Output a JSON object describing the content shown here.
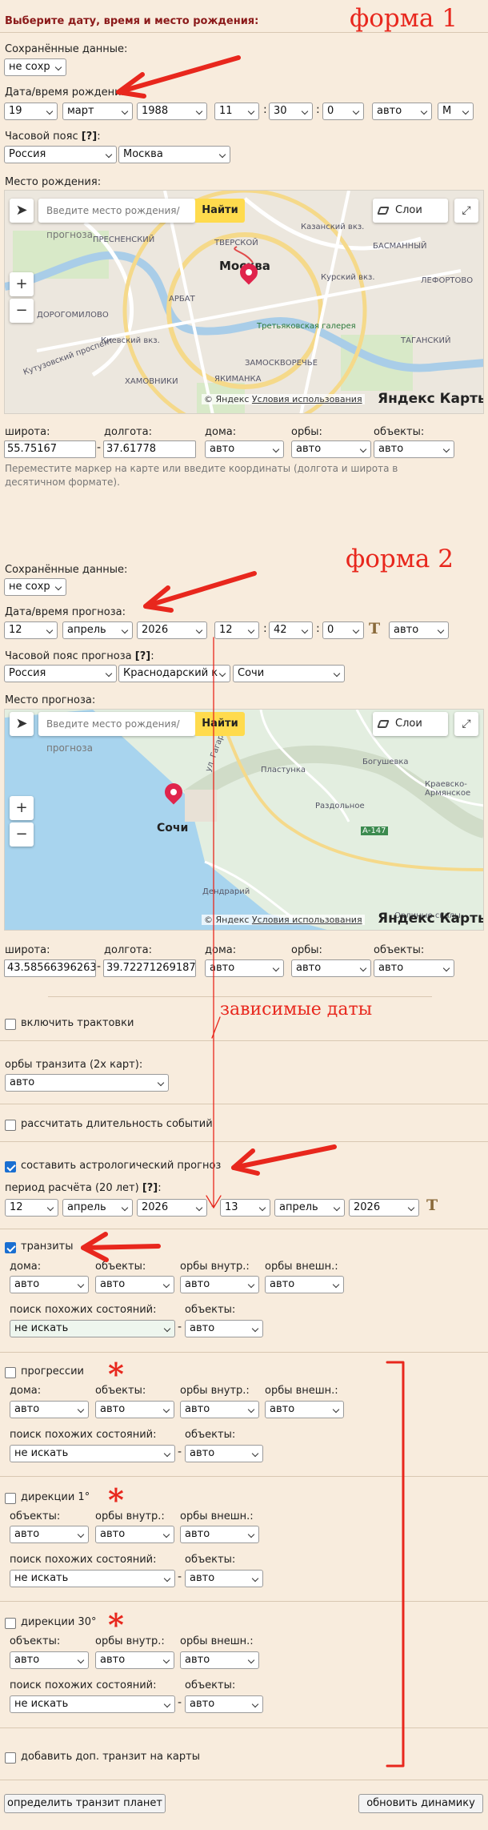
{
  "form1": {
    "title": "Выберите дату, время и место рождения:",
    "annotation": "форма 1",
    "saved_label": "Сохранённые данные:",
    "saved_value": "не сохр",
    "datetime_label": "Дата/время рождения:",
    "day": "19",
    "month": "март",
    "year": "1988",
    "hour": "11",
    "minute": "30",
    "second": "0",
    "mode": "авто",
    "last": "М",
    "tz_label": "Часовой пояс",
    "tz_help": "[?]",
    "tz_colon": ":",
    "tz_country": "Россия",
    "tz_city": "Москва",
    "place_label": "Место рождения:",
    "map": {
      "search_placeholder": "Введите место рождения/прогноза",
      "find": "Найти",
      "layers": "Слои",
      "copyright": "© Яндекс",
      "terms": "Условия использования",
      "logo": "Яндекс Карты",
      "labels": [
        "Москва",
        "ПРЕСНЕНСКИЙ",
        "ТВЕРСКОЙ",
        "Казанский вкз.",
        "БАСМАННЫЙ",
        "Курский вкз.",
        "ЛЕФОРТОВО",
        "ТАГАНСКИЙ",
        "Третьяковская галерея",
        "ЗАМОСКВОРЕЧЬЕ",
        "ЯКИМАНКА",
        "ХАМОВНИКИ",
        "АРБАТ",
        "Киевский вкз.",
        "ДОРОГОМИЛОВО",
        "Кутузовский проспект"
      ]
    },
    "lat_label": "широта:",
    "lon_label": "долгота:",
    "houses_label": "дома:",
    "orbs_label": "орбы:",
    "objects_label": "объекты:",
    "lat": "55.75167",
    "lon": "37.61778",
    "houses": "авто",
    "orbs": "авто",
    "objects": "авто",
    "hint": "Переместите маркер на карте или введите координаты (долгота и широта в десятичном формате)."
  },
  "form2": {
    "annotation": "форма 2",
    "saved_label": "Сохранённые данные:",
    "saved_value": "не сохр",
    "datetime_label": "Дата/время прогноза:",
    "day": "12",
    "month": "апрель",
    "year": "2026",
    "hour": "12",
    "minute": "42",
    "second": "0",
    "t_icon": "T",
    "mode": "авто",
    "tz_label": "Часовой пояс прогноза",
    "tz_help": "[?]",
    "tz_colon": ":",
    "tz_country": "Россия",
    "tz_region": "Краснодарский к",
    "tz_city": "Сочи",
    "place_label": "Место прогноза:",
    "map": {
      "search_placeholder": "Введите место рождения/прогноза",
      "find": "Найти",
      "layers": "Слои",
      "copyright": "© Яндекс",
      "terms": "Условия использования",
      "logo": "Яндекс Карты",
      "labels": [
        "Сочи",
        "Богушевка",
        "Краевско-Армянское",
        "Раздольное",
        "Дендрарий",
        "Орлиные скалы",
        "ул. Гагарина",
        "А-147",
        "Пластунка"
      ]
    },
    "lat_label": "широта:",
    "lon_label": "долгота:",
    "houses_label": "дома:",
    "orbs_label": "орбы:",
    "objects_label": "объекты:",
    "lat": "43.58566396263",
    "lon": "39.72271269187",
    "houses": "авто",
    "orbs": "авто",
    "objects": "авто"
  },
  "dependent_dates_annotation": "зависимые даты",
  "options": {
    "interpretations_label": "включить трактовки",
    "transit_orbs_label": "орбы транзита (2x карт):",
    "transit_orbs_value": "авто",
    "durations_label": "рассчитать длительность событий",
    "forecast_label": "составить астрологический прогноз",
    "period_label": "период расчёта (20 лет)",
    "period_help": "[?]",
    "period_colon": ":",
    "period_from": {
      "day": "12",
      "month": "апрель",
      "year": "2026"
    },
    "period_to": {
      "day": "13",
      "month": "апрель",
      "year": "2026"
    },
    "period_t_icon": "T"
  },
  "transits": {
    "label": "транзиты",
    "houses_label": "дома:",
    "objects_label": "объекты:",
    "orbs_in_label": "орбы внутр.:",
    "orbs_out_label": "орбы внешн.:",
    "houses": "авто",
    "objects": "авто",
    "orbs_in": "авто",
    "orbs_out": "авто",
    "similar_label": "поиск похожих состояний:",
    "similar_objects_label": "объекты:",
    "similar": "не искать",
    "dash": "-",
    "similar_objects": "авто"
  },
  "progressions": {
    "label": "прогрессии",
    "houses_label": "дома:",
    "objects_label": "объекты:",
    "orbs_in_label": "орбы внутр.:",
    "orbs_out_label": "орбы внешн.:",
    "houses": "авто",
    "objects": "авто",
    "orbs_in": "авто",
    "orbs_out": "авто",
    "similar_label": "поиск похожих состояний:",
    "similar_objects_label": "объекты:",
    "similar": "не искать",
    "dash": "-",
    "similar_objects": "авто"
  },
  "directions1": {
    "label": "дирекции 1°",
    "objects_label": "объекты:",
    "orbs_in_label": "орбы внутр.:",
    "orbs_out_label": "орбы внешн.:",
    "objects": "авто",
    "orbs_in": "авто",
    "orbs_out": "авто",
    "similar_label": "поиск похожих состояний:",
    "similar_objects_label": "объекты:",
    "similar": "не искать",
    "dash": "-",
    "similar_objects": "авто"
  },
  "directions30": {
    "label": "дирекции 30°",
    "objects_label": "объекты:",
    "orbs_in_label": "орбы внутр.:",
    "orbs_out_label": "орбы внешн.:",
    "objects": "авто",
    "orbs_in": "авто",
    "orbs_out": "авто",
    "similar_label": "поиск похожих состояний:",
    "similar_objects_label": "объекты:",
    "similar": "не искать",
    "dash": "-",
    "similar_objects": "авто"
  },
  "add_transit_label": "добавить доп. транзит на карты",
  "buttons": {
    "transit": "определить транзит планет",
    "refresh": "обновить динамику"
  },
  "asterisk": "*",
  "colors": {
    "background": "#f8ecdd",
    "annotation": "#e8271d",
    "title": "#8b1a1a",
    "checkbox": "#1a6fd1"
  }
}
